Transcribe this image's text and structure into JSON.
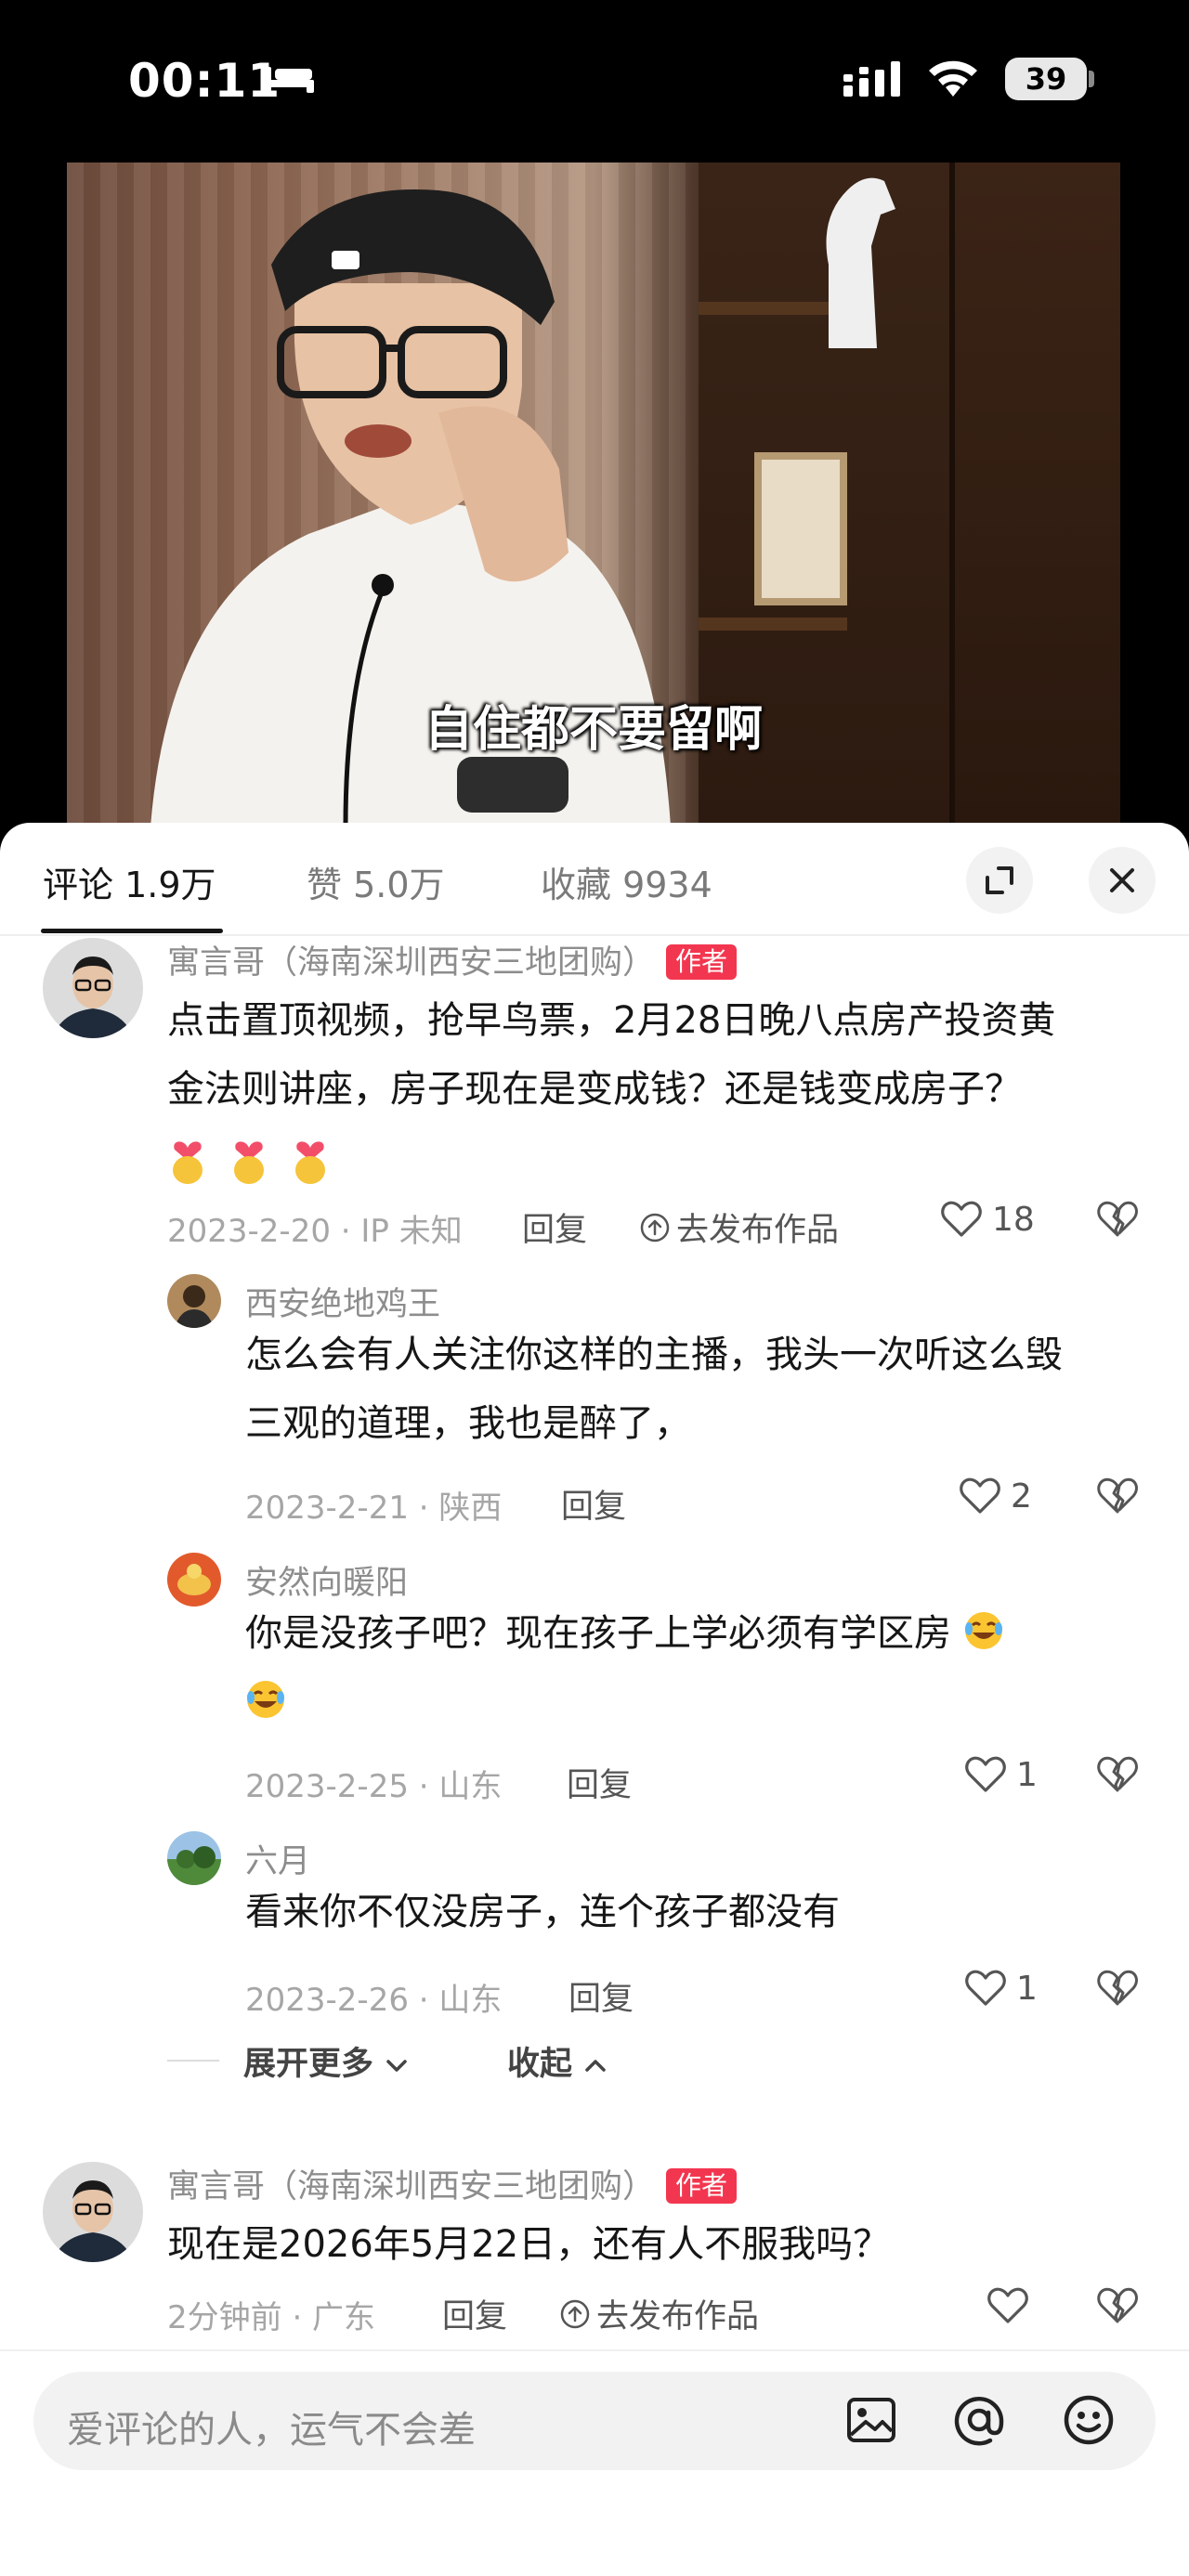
{
  "status_bar": {
    "time": "00:11",
    "battery": "39"
  },
  "video": {
    "subtitle": "自住都不要留啊"
  },
  "tabs": [
    {
      "label": "评论 1.9万"
    },
    {
      "label": "赞 5.0万"
    },
    {
      "label": "收藏 9934"
    }
  ],
  "comments": [
    {
      "user": "寓言哥（海南深圳西安三地团购）",
      "badge": "作者",
      "text_line1": "点击置顶视频，抢早鸟票，2月28日晚八点房产投资黄",
      "text_line2": "金法则讲座，房子现在是变成钱？还是钱变成房子？",
      "date": "2023-2-20 · IP 未知",
      "reply": "回复",
      "publish": "去发布作品",
      "likes": "18"
    },
    {
      "user": "西安绝地鸡王",
      "text_line1": "怎么会有人关注你这样的主播，我头一次听这么毁",
      "text_line2": "三观的道理，我也是醉了，",
      "date": "2023-2-21 · 陕西",
      "reply": "回复",
      "likes": "2"
    },
    {
      "user": "安然向暖阳",
      "text_line1": "你是没孩子吧？现在孩子上学必须有学区房",
      "date": "2023-2-25 · 山东",
      "reply": "回复",
      "likes": "1"
    },
    {
      "user": "六月",
      "text_line1": "看来你不仅没房子，连个孩子都没有",
      "date": "2023-2-26 · 山东",
      "reply": "回复",
      "likes": "1"
    },
    {
      "user": "寓言哥（海南深圳西安三地团购）",
      "badge": "作者",
      "text_line1": "现在是2026年5月22日，还有人不服我吗？",
      "date": "2分钟前 · 广东",
      "reply": "回复",
      "publish": "去发布作品",
      "likes": ""
    }
  ],
  "expand": {
    "more": "展开更多",
    "collapse": "收起"
  },
  "input": {
    "placeholder": "爱评论的人，运气不会差"
  }
}
